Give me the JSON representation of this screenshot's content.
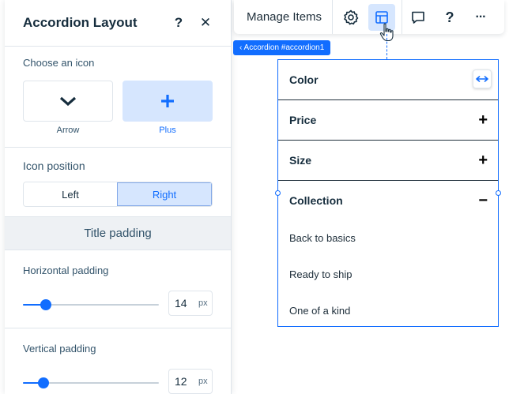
{
  "panel": {
    "title": "Accordion Layout",
    "help_label": "?",
    "close_label": "✕",
    "choose_icon": {
      "label": "Choose an icon",
      "options": [
        {
          "caption": "Arrow",
          "icon": "chevron-down-icon",
          "selected": false
        },
        {
          "caption": "Plus",
          "icon": "plus-icon",
          "selected": true
        }
      ]
    },
    "icon_position": {
      "label": "Icon position",
      "options": [
        "Left",
        "Right"
      ],
      "selected": "Right"
    },
    "title_padding": {
      "heading": "Title padding",
      "horizontal": {
        "label": "Horizontal padding",
        "value": "14",
        "unit": "px",
        "slider_fraction": 0.17
      },
      "vertical": {
        "label": "Vertical padding",
        "value": "12",
        "unit": "px",
        "slider_fraction": 0.15
      }
    }
  },
  "toolbar": {
    "manage_items": "Manage Items",
    "icons": [
      "gear-icon",
      "layout-icon",
      "comment-icon",
      "help-icon",
      "more-icon"
    ],
    "active": "layout-icon",
    "help_label": "?",
    "more_label": "···"
  },
  "canvas": {
    "tag": "‹ Accordion #accordion1",
    "rows": [
      {
        "title": "Color",
        "sign": ""
      },
      {
        "title": "Price",
        "sign": "+"
      },
      {
        "title": "Size",
        "sign": "+"
      },
      {
        "title": "Collection",
        "sign": "−"
      }
    ],
    "items": [
      "Back to basics",
      "Ready to ship",
      "One of a kind"
    ]
  },
  "colors": {
    "accent": "#116dff",
    "accent_light": "#d6e6fe",
    "text": "#162d3d",
    "border": "#dfe5eb"
  }
}
